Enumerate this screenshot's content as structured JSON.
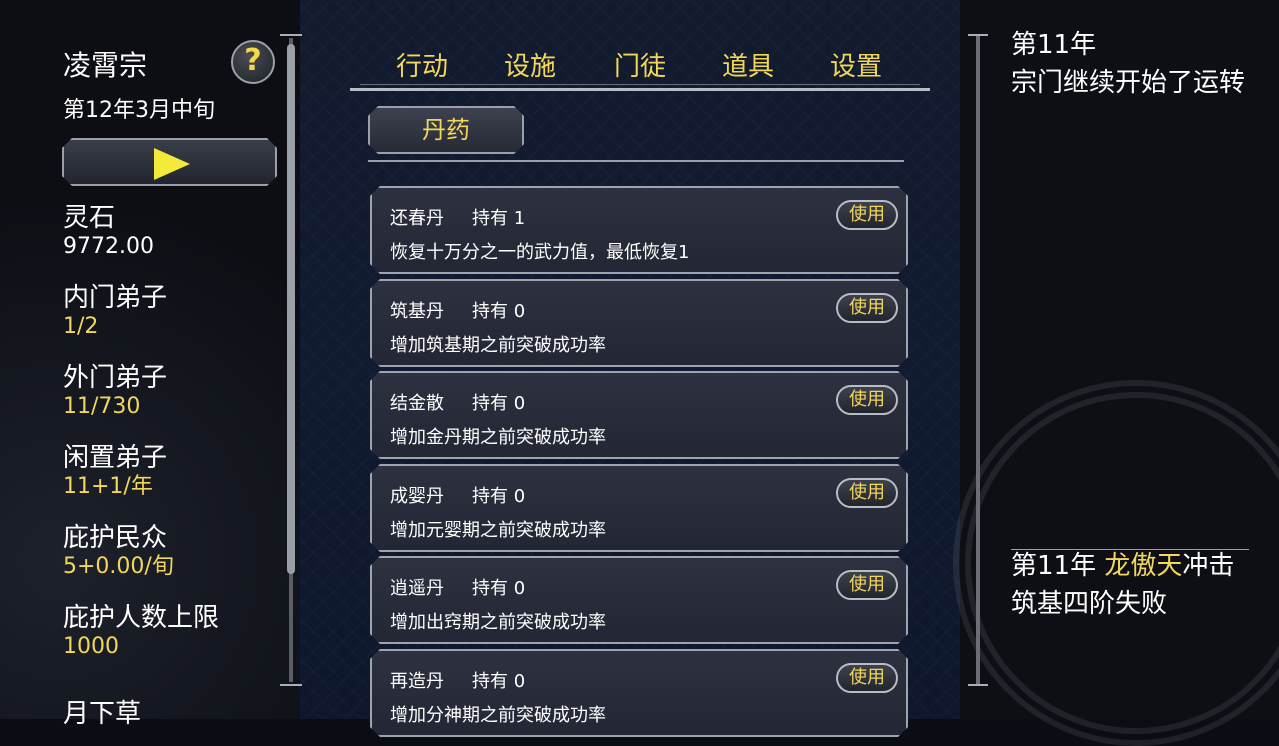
{
  "sidebar": {
    "sect_name": "凌霄宗",
    "help_label": "?",
    "date": "第12年3月中旬",
    "stats": [
      {
        "label": "灵石",
        "value": "9772.00",
        "value_a": "",
        "value_b": ""
      },
      {
        "label": "内门弟子",
        "value": "",
        "value_a": "1",
        "value_b": "/2"
      },
      {
        "label": "外门弟子",
        "value": "",
        "value_a": "11",
        "value_b": "/730"
      },
      {
        "label": "闲置弟子",
        "value": "",
        "value_a": "11",
        "value_b": "+1/年"
      },
      {
        "label": "庇护民众",
        "value": "",
        "value_a": "5",
        "value_b": "+0.00/旬"
      },
      {
        "label": "庇护人数上限",
        "value": "",
        "value_a": "",
        "value_b": "1000"
      },
      {
        "label": "月下草",
        "value": "",
        "value_a": "",
        "value_b": ""
      }
    ]
  },
  "tabs": [
    "行动",
    "设施",
    "门徒",
    "道具",
    "设置"
  ],
  "subtab": "丹药",
  "items": [
    {
      "name": "还春丹",
      "owned": "持有 1",
      "desc": "恢复十万分之一的武力值，最低恢复1",
      "use": "使用"
    },
    {
      "name": "筑基丹",
      "owned": "持有 0",
      "desc": "增加筑基期之前突破成功率",
      "use": "使用"
    },
    {
      "name": "结金散",
      "owned": "持有 0",
      "desc": "增加金丹期之前突破成功率",
      "use": "使用"
    },
    {
      "name": "成婴丹",
      "owned": "持有 0",
      "desc": "增加元婴期之前突破成功率",
      "use": "使用"
    },
    {
      "name": "逍遥丹",
      "owned": "持有 0",
      "desc": "增加出窍期之前突破成功率",
      "use": "使用"
    },
    {
      "name": "再造丹",
      "owned": "持有 0",
      "desc": "增加分神期之前突破成功率",
      "use": "使用"
    }
  ],
  "log": {
    "entry1": "第11年\n宗门继续开始了运转",
    "entry2_prefix": "第11年 ",
    "entry2_name": "龙傲天",
    "entry2_suffix": "冲击筑基四阶失败"
  },
  "colors": {
    "accent_yellow": "#f2d75a",
    "play_yellow": "#f4ea3a"
  }
}
